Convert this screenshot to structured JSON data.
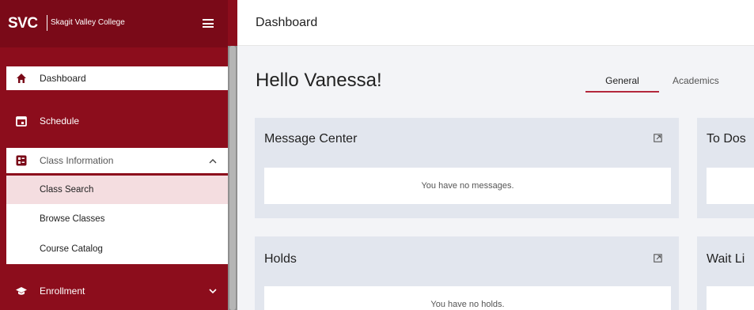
{
  "brand": {
    "logo_text": "SVC",
    "college_name": "Skagit Valley College"
  },
  "sidebar": {
    "items": [
      {
        "label": "Dashboard",
        "icon": "home-icon"
      },
      {
        "label": "Schedule",
        "icon": "calendar-icon"
      },
      {
        "label": "Class Information",
        "icon": "class-info-icon"
      },
      {
        "label": "Enrollment",
        "icon": "graduation-cap-icon"
      }
    ],
    "class_info_subitems": [
      "Class Search",
      "Browse Classes",
      "Course Catalog"
    ]
  },
  "header": {
    "title": "Dashboard"
  },
  "main": {
    "greeting": "Hello Vanessa!",
    "tabs": [
      "General",
      "Academics"
    ],
    "cards": [
      {
        "title": "Message Center",
        "message": "You have no messages."
      },
      {
        "title": "To Dos",
        "message": ""
      },
      {
        "title": "Holds",
        "message": "You have no holds."
      },
      {
        "title": "Wait Li",
        "message": ""
      }
    ]
  },
  "colors": {
    "brand_red": "#8c0d1c",
    "accent_red": "#b3283c",
    "card_bg": "#e2e6ee",
    "page_bg": "#f3f4f7"
  }
}
